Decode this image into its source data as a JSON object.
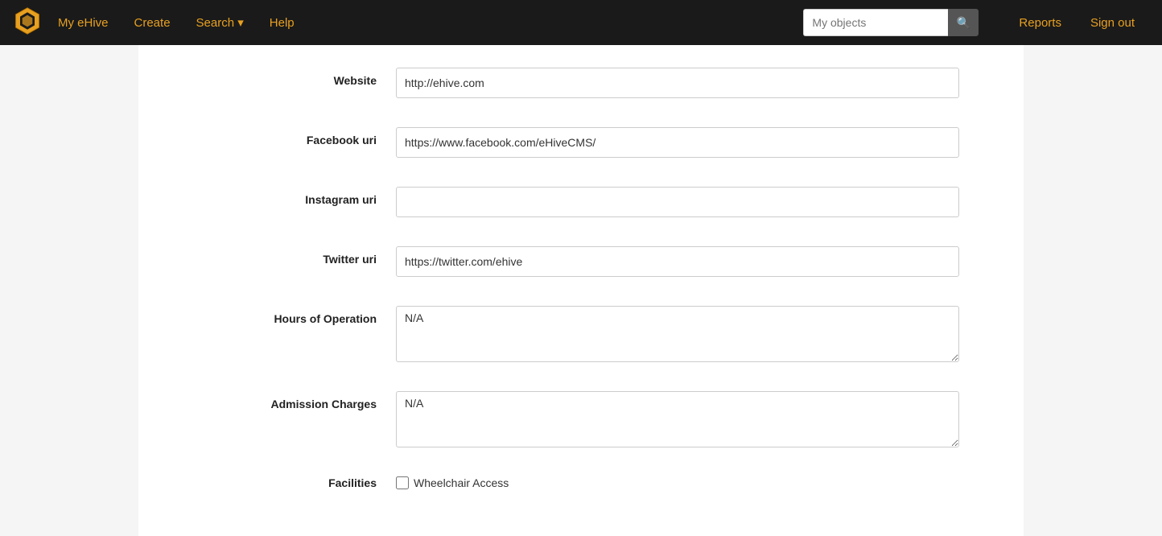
{
  "navbar": {
    "logo_alt": "eHive logo",
    "links": [
      {
        "id": "my-ehive",
        "label": "My eHive"
      },
      {
        "id": "create",
        "label": "Create"
      },
      {
        "id": "search",
        "label": "Search ▾"
      },
      {
        "id": "help",
        "label": "Help"
      }
    ],
    "search_placeholder": "My objects",
    "search_btn_icon": "🔍",
    "right_links": [
      {
        "id": "reports",
        "label": "Reports"
      },
      {
        "id": "sign-out",
        "label": "Sign out"
      }
    ]
  },
  "form": {
    "fields": [
      {
        "id": "website",
        "label": "Website",
        "type": "input",
        "value": "http://ehive.com"
      },
      {
        "id": "facebook-uri",
        "label": "Facebook uri",
        "type": "input",
        "value": "https://www.facebook.com/eHiveCMS/"
      },
      {
        "id": "instagram-uri",
        "label": "Instagram uri",
        "type": "input",
        "value": ""
      },
      {
        "id": "twitter-uri",
        "label": "Twitter uri",
        "type": "input",
        "value": "https://twitter.com/ehive"
      },
      {
        "id": "hours-of-operation",
        "label": "Hours of Operation",
        "type": "textarea",
        "value": "N/A"
      },
      {
        "id": "admission-charges",
        "label": "Admission Charges",
        "type": "textarea",
        "value": "N/A"
      }
    ],
    "facilities": {
      "label": "Facilities",
      "checkbox_label": "Wheelchair Access",
      "checked": false
    }
  }
}
